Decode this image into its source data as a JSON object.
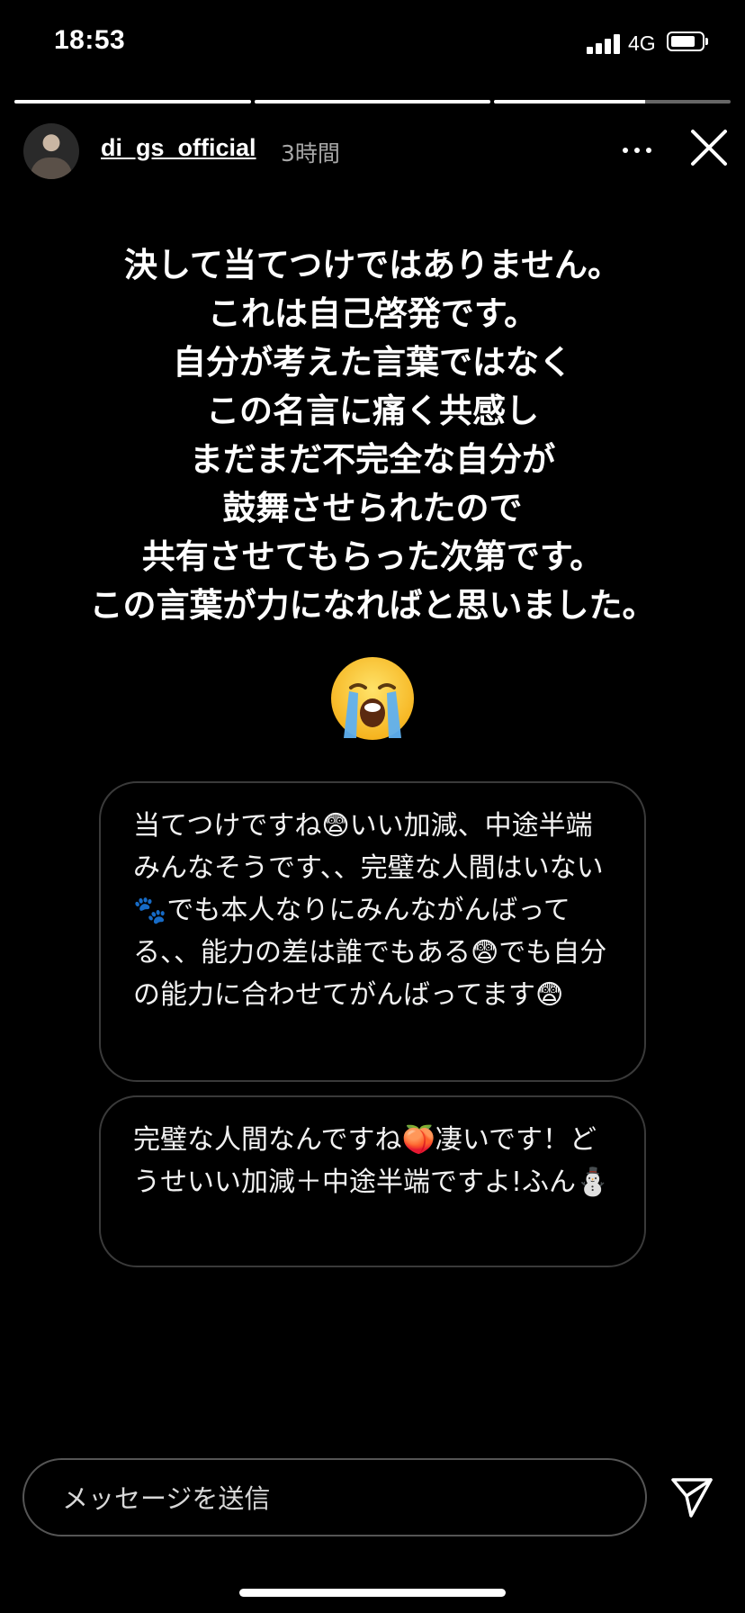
{
  "status_bar": {
    "time": "18:53",
    "network": "4G",
    "icons": [
      "signal-icon",
      "battery-icon"
    ]
  },
  "story": {
    "progress": [
      1.0,
      1.0,
      0.64
    ],
    "username": "di_gs_official",
    "post_age": "3時間",
    "text_lines": [
      "決して当てつけではありません。",
      "これは自己啓発です。",
      "自分が考えた言葉ではなく",
      "この名言に痛く共感し",
      "まだまだ不完全な自分が",
      "鼓舞させられたので",
      "共有させてもらった次第です。",
      "この言葉が力になればと思いました。"
    ],
    "emoji": "😭"
  },
  "replies": [
    {
      "text": "当てつけですね😨いい加減、中途半端みんなそうです、、完璧な人間はいない🐾でも本人なりにみんながんばってる、、能力の差は誰でもある😨でも自分の能力に合わせてがんばってます😨"
    },
    {
      "text": "完璧な人間なんですね🍑凄いです！どうせいい加減＋中途半端ですよ!ふん⛄"
    }
  ],
  "composer": {
    "placeholder": "メッセージを送信"
  },
  "colors": {
    "background": "#000000",
    "text": "#ffffff",
    "muted": "#a8a8a8",
    "bubble_border": "#3a3a3a"
  }
}
